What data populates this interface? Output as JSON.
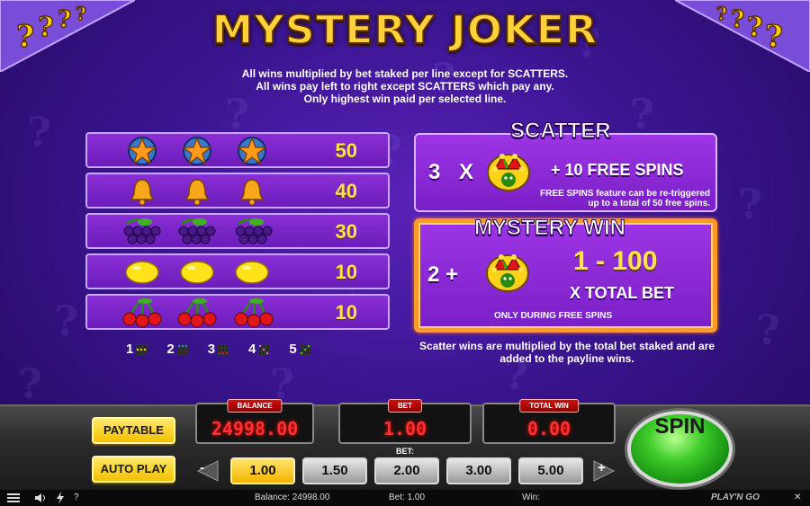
{
  "game_title": "MYSTERY JOKER",
  "rules": {
    "line1": "All wins multiplied by bet staked per line except for SCATTERS.",
    "line2": "All wins pay left to right except SCATTERS which pay any.",
    "line3": "Only highest win paid per selected line."
  },
  "paytable": [
    {
      "symbol": "star-icon",
      "value": "50"
    },
    {
      "symbol": "bell-icon",
      "value": "40"
    },
    {
      "symbol": "grapes-icon",
      "value": "30"
    },
    {
      "symbol": "lemon-icon",
      "value": "10"
    },
    {
      "symbol": "cherries-icon",
      "value": "10"
    }
  ],
  "paylines": [
    "1",
    "2",
    "3",
    "4",
    "5"
  ],
  "scatter": {
    "title": "SCATTER",
    "count": "3",
    "times": "X",
    "reward": "+ 10 FREE SPINS",
    "note1": "FREE SPINS feature can be re-triggered",
    "note2": "up to a total of 50 free spins."
  },
  "mystery_win": {
    "title": "MYSTERY WIN",
    "count": "2 +",
    "range": "1 - 100",
    "multiplier": "X TOTAL BET",
    "condition": "ONLY DURING FREE SPINS"
  },
  "scatter_footnote": {
    "line1": "Scatter wins are multiplied by the total bet staked and are",
    "line2": "added to the payline wins."
  },
  "meters": {
    "balance_label": "BALANCE",
    "balance_value": "24998.00",
    "bet_label": "BET",
    "bet_value": "1.00",
    "total_win_label": "TOTAL WIN",
    "total_win_value": "0.00"
  },
  "buttons": {
    "paytable": "PAYTABLE",
    "auto_play": "AUTO PLAY",
    "spin": "SPIN",
    "minus": "-",
    "plus": "+"
  },
  "bet_selector": {
    "label": "BET:",
    "options": [
      "1.00",
      "1.50",
      "2.00",
      "3.00",
      "5.00"
    ],
    "selected": "1.00"
  },
  "status_bar": {
    "balance": "Balance: 24998.00",
    "bet": "Bet: 1.00",
    "win": "Win:",
    "brand": "PLAY'N GO",
    "close": "✕",
    "help": "?"
  },
  "colors": {
    "accent_gold": "#ffe34a",
    "meter_red": "#ff3030",
    "spin_green": "#3fcc2a"
  }
}
